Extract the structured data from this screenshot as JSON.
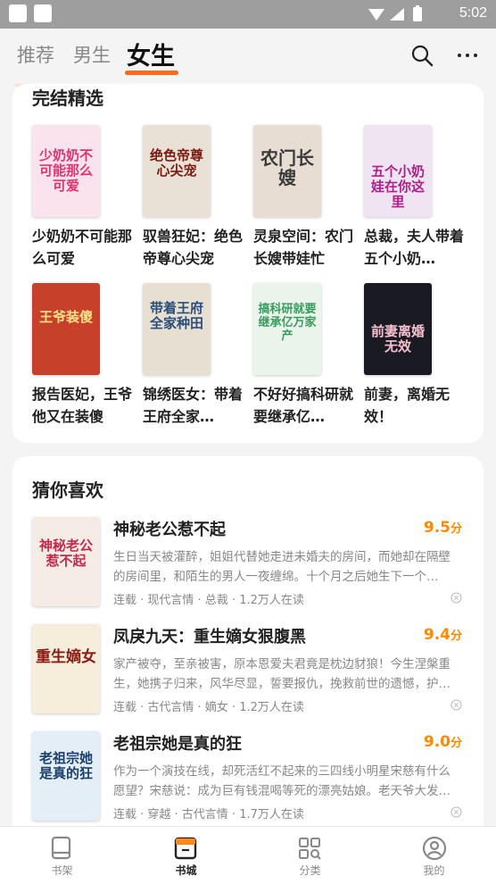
{
  "status_bar": {
    "time": "5:02"
  },
  "header": {
    "tabs": [
      {
        "label": "推荐",
        "active": false
      },
      {
        "label": "男生",
        "active": false
      },
      {
        "label": "女生",
        "active": true
      }
    ],
    "icons": [
      "search-icon",
      "more-icon"
    ]
  },
  "completed_section": {
    "title": "完结精选",
    "books": [
      {
        "title": "少奶奶不可能那么可爱",
        "cover_text": "少奶奶不可能那么可爱",
        "cover_color": "#fbe3ee",
        "text_color": "#e0336f"
      },
      {
        "title": "驭兽狂妃：绝色帝尊心尖宠",
        "cover_text": "绝色帝尊心尖宠",
        "cover_color": "#e9e1d6",
        "text_color": "#7a1a10"
      },
      {
        "title": "灵泉空间：农门长嫂带娃忙",
        "cover_text": "农门长嫂",
        "cover_color": "#e7ddd3",
        "text_color": "#3a3a3a"
      },
      {
        "title": "总裁，夫人带着五个小奶…",
        "cover_text": "五个小奶娃在你这里",
        "cover_color": "#efe4f1",
        "text_color": "#b0208a"
      },
      {
        "title": "报告医妃，王爷他又在装傻",
        "cover_text": "王爷装傻",
        "cover_color": "#c7412a",
        "text_color": "#fce18a"
      },
      {
        "title": "锦绣医女：带着王府全家…",
        "cover_text": "带着王府全家种田",
        "cover_color": "#e7e0d2",
        "text_color": "#2a4e79"
      },
      {
        "title": "不好好搞科研就要继承亿…",
        "cover_text": "搞科研就要继承亿万家产",
        "cover_color": "#eaf4ea",
        "text_color": "#3a9b61"
      },
      {
        "title": "前妻，离婚无效！",
        "cover_text": "前妻离婚无效",
        "cover_color": "#1a1a22",
        "text_color": "#f7c0d0"
      }
    ]
  },
  "guess_section": {
    "title": "猜你喜欢",
    "items": [
      {
        "title": "神秘老公惹不起",
        "score": "9.5",
        "score_unit": "分",
        "desc": "生日当天被灌醉，姐姐代替她走进未婚夫的房间，而她却在隔壁的房间里，和陌生的男人一夜缠绵。十个月之后她生下一个…",
        "meta": "连载 · 现代言情 · 总裁 · 1.2万人在读",
        "cover_text": "神秘老公惹不起",
        "cover_color": "#f6ece6",
        "text_color": "#c22a4d"
      },
      {
        "title": "凤戾九天：重生嫡女狠腹黑",
        "score": "9.4",
        "score_unit": "分",
        "desc": "家产被夺，至亲被害，原本恩爱夫君竟是枕边豺狼！今生涅槃重生，她携子归来，风华尽显，誓要报仇，挽救前世的遗憾，护…",
        "meta": "连载 · 古代言情 · 嫡女 · 1.2万人在读",
        "cover_text": "重生嫡女",
        "cover_color": "#f6eedb",
        "text_color": "#8a1a12"
      },
      {
        "title": "老祖宗她是真的狂",
        "score": "9.0",
        "score_unit": "分",
        "desc": "作为一个演技在线，却死活红不起来的三四线小明星宋慈有什么愿望？宋慈说：成为巨有钱混喝等死的漂亮姑娘。老天爷大发…",
        "meta": "连载 · 穿越 · 古代言情 · 1.7万人在读",
        "cover_text": "老祖宗她是真的狂",
        "cover_color": "#e4eef6",
        "text_color": "#1b3f6b"
      }
    ]
  },
  "bottom_nav": [
    {
      "label": "书架",
      "icon": "bookshelf-icon",
      "active": false
    },
    {
      "label": "书城",
      "icon": "bookstore-icon",
      "active": true
    },
    {
      "label": "分类",
      "icon": "category-icon",
      "active": false
    },
    {
      "label": "我的",
      "icon": "profile-icon",
      "active": false
    }
  ],
  "colors": {
    "accent": "#ff6a1a",
    "score": "#ff8a00",
    "status_bar": "#9e9e9e"
  }
}
